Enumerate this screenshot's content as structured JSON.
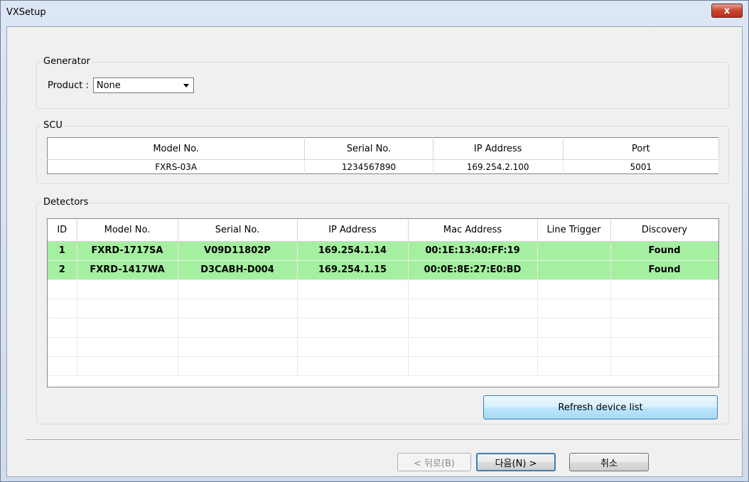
{
  "window": {
    "title": "VXSetup",
    "close_glyph": "x"
  },
  "generator": {
    "label": "Generator",
    "product_label": "Product :",
    "product_value": "None"
  },
  "scu": {
    "label": "SCU",
    "columns": [
      "Model No.",
      "Serial No.",
      "IP Address",
      "Port"
    ],
    "rows": [
      [
        "FXRS-03A",
        "1234567890",
        "169.254.2.100",
        "5001"
      ]
    ]
  },
  "detectors": {
    "label": "Detectors",
    "columns": [
      "ID",
      "Model No.",
      "Serial No.",
      "IP Address",
      "Mac Address",
      "Line Trigger",
      "Discovery"
    ],
    "rows": [
      [
        "1",
        "FXRD-1717SA",
        "V09D11802P",
        "169.254.1.14",
        "00:1E:13:40:FF:19",
        "",
        "Found"
      ],
      [
        "2",
        "FXRD-1417WA",
        "D3CABH-D004",
        "169.254.1.15",
        "00:0E:8E:27:E0:BD",
        "",
        "Found"
      ]
    ],
    "found_color": "#a4f0a0",
    "refresh_label": "Refresh device list"
  },
  "nav": {
    "back_label": "< 뒤로(B)",
    "next_label": "다음(N) >",
    "cancel_label": "취소"
  }
}
